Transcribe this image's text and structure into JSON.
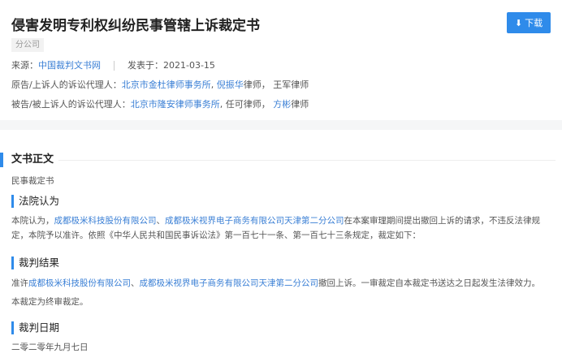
{
  "header": {
    "title": "侵害发明专利权纠纷民事管辖上诉裁定书",
    "download_label": "下载",
    "tag": "分公司",
    "source_label": "来源：",
    "source_value": "中国裁判文书网",
    "published_label": "发表于：",
    "published_value": "2021-03-15",
    "plaintiff_label": "原告/上诉人的诉讼代理人：",
    "plaintiff_firm": "北京市金杜律师事务所",
    "plaintiff_lawyer1": "倪振华",
    "plaintiff_lawyer1_suffix": "律师，",
    "plaintiff_lawyer2": "王军律师",
    "defendant_label": "被告/被上诉人的诉讼代理人：",
    "defendant_firm": "北京市隆安律师事务所",
    "defendant_lawyer1": ", 任可律师，",
    "defendant_lawyer2": "方彬",
    "defendant_lawyer2_suffix": "律师"
  },
  "body": {
    "section_title": "文书正文",
    "doc_type": "民事裁定书",
    "court_opinion": {
      "heading": "法院认为",
      "prefix": "本院认为，",
      "party1": "成都极米科技股份有限公司",
      "sep": "、",
      "party2": "成都极米视界电子商务有限公司天津第二分公司",
      "rest": "在本案审理期间提出撤回上诉的请求，不违反法律规定，本院予以准许。依照《中华人民共和国民事诉讼法》第一百七十一条、第一百七十三条规定，裁定如下："
    },
    "result": {
      "heading": "裁判结果",
      "prefix": "准许",
      "party1": "成都极米科技股份有限公司",
      "sep": "、",
      "party2": "成都极米视界电子商务有限公司天津第二分公司",
      "rest": "撤回上诉。一审裁定自本裁定书送达之日起发生法律效力。",
      "final": "本裁定为终审裁定。"
    },
    "date": {
      "heading": "裁判日期",
      "value": "二零二零年九月七日"
    }
  }
}
